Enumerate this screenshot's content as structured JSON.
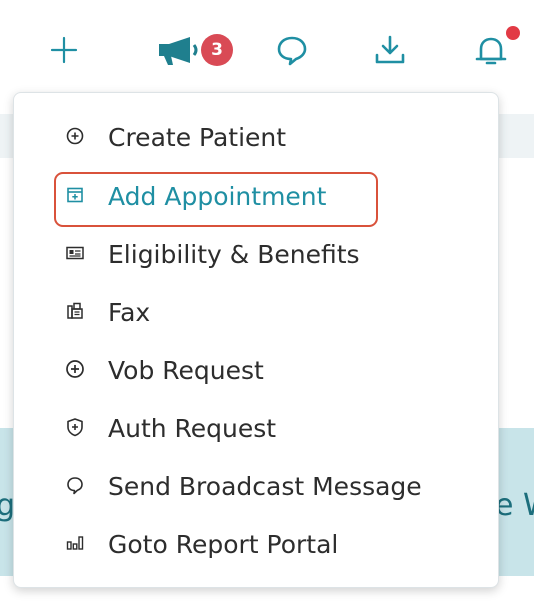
{
  "toolbar": {
    "announcements_badge": "3"
  },
  "background": {
    "left_fragment": "g",
    "right_fragment": "e W"
  },
  "menu": {
    "items": [
      {
        "label": "Create Patient",
        "icon": "plus-circle-icon"
      },
      {
        "label": "Add Appointment",
        "icon": "calendar-plus-icon",
        "highlighted": true
      },
      {
        "label": "Eligibility & Benefits",
        "icon": "id-card-icon"
      },
      {
        "label": "Fax",
        "icon": "fax-icon"
      },
      {
        "label": "Vob Request",
        "icon": "plus-circle-icon"
      },
      {
        "label": "Auth Request",
        "icon": "shield-plus-icon"
      },
      {
        "label": "Send Broadcast Message",
        "icon": "chat-bubble-icon"
      },
      {
        "label": "Goto Report Portal",
        "icon": "bar-chart-icon"
      }
    ]
  },
  "colors": {
    "accent": "#1f8fa3",
    "badge": "#d94a55",
    "highlight_border": "#d9523b",
    "band": "#c8e4e9"
  }
}
